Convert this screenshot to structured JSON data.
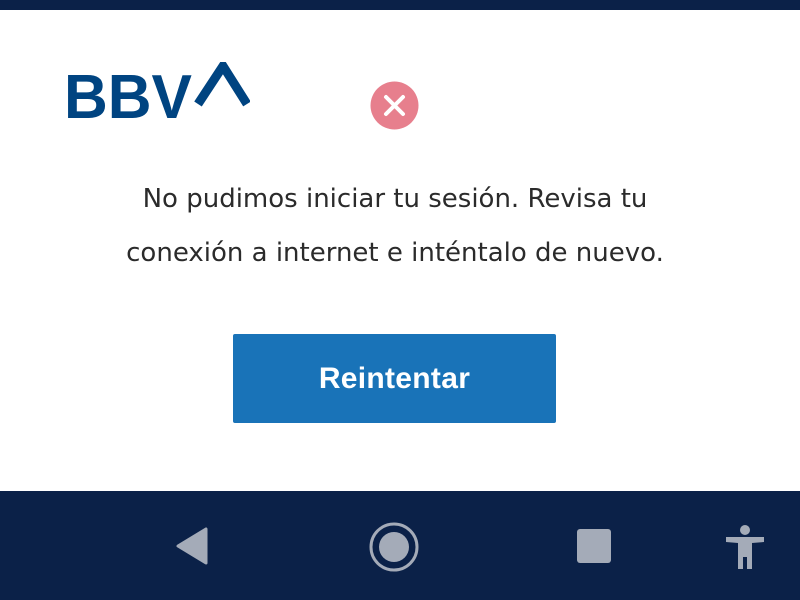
{
  "brand": {
    "logo_text": "BBVA",
    "color": "#004481"
  },
  "dialog": {
    "icon": "error-x-icon",
    "icon_color": "#e77f8d",
    "message_lines": [
      "No pudimos iniciar tu sesión. Revisa tu",
      "conexión a internet e inténtalo de nuevo."
    ],
    "retry_label": "Reintentar",
    "button_color": "#1973b8"
  },
  "navigation_bar": {
    "background": "#0b2148",
    "items": [
      {
        "name": "back",
        "icon": "back-triangle-icon"
      },
      {
        "name": "home",
        "icon": "home-circle-icon"
      },
      {
        "name": "recents",
        "icon": "recents-square-icon"
      },
      {
        "name": "accessibility",
        "icon": "accessibility-icon"
      }
    ]
  }
}
